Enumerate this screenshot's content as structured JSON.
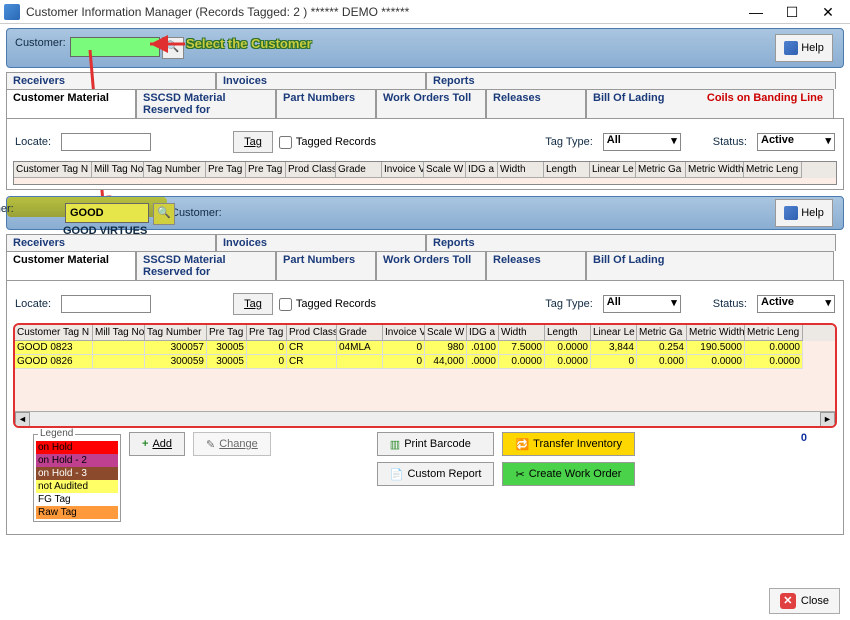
{
  "window": {
    "title": "Customer Information Manager  (Records Tagged:  2 )    ****** DEMO ******",
    "min": "—",
    "max": "☐",
    "close": "✕"
  },
  "toolbar1": {
    "customer_label": "Customer:",
    "customer_value": "",
    "help": "Help"
  },
  "annotation": {
    "select_customer": "Select the Customer"
  },
  "tabs_row1": [
    "Receivers",
    "Invoices",
    "Reports"
  ],
  "tabs_row2": [
    "Customer Material",
    "SSCSD Material Reserved for",
    "Part Numbers",
    "Work Orders Toll",
    "Releases",
    "Bill Of Lading"
  ],
  "banding_text": "Coils on Banding Line",
  "filter": {
    "locate_label": "Locate:",
    "locate_value": "",
    "tag_btn": "Tag",
    "tagged_records": "Tagged Records",
    "tag_type_label": "Tag Type:",
    "tag_type_value": "All",
    "status_label": "Status:",
    "status_value": "Active"
  },
  "columns": [
    "Customer Tag N",
    "Mill Tag No",
    "Tag Number",
    "Pre Tag",
    "Pre Tag",
    "Prod Class",
    "Grade",
    "Invoice V",
    "Scale W",
    "IDG a",
    "Width",
    "Length",
    "Linear Le",
    "Metric Ga",
    "Metric Width",
    "Metric Leng"
  ],
  "toolbar2": {
    "customer_label": "Customer:",
    "customer_value": "GOOD",
    "customer_name": "GOOD VIRTUES",
    "help": "Help"
  },
  "rows": [
    {
      "c1": "GOOD 0823",
      "c2": "",
      "c3": "300057",
      "c4": "30005",
      "c5": "0",
      "c6": "CR",
      "c7": "04MLA",
      "c8": "0",
      "c9": "980",
      "c10": ".0100",
      "c11": "7.5000",
      "c12": "0.0000",
      "c13": "3,844",
      "c14": "0.254",
      "c15": "190.5000",
      "c16": "0.0000"
    },
    {
      "c1": "GOOD 0826",
      "c2": "",
      "c3": "300059",
      "c4": "30005",
      "c5": "0",
      "c6": "CR",
      "c7": "",
      "c8": "0",
      "c9": "44,000",
      "c10": ".0000",
      "c11": "0.0000",
      "c12": "0.0000",
      "c13": "0",
      "c14": "0.000",
      "c15": "0.0000",
      "c16": "0.0000"
    }
  ],
  "legend": {
    "title": "Legend",
    "items": [
      "on Hold",
      "on Hold - 2",
      "on Hold - 3",
      "not Audited",
      "FG Tag",
      "Raw Tag"
    ]
  },
  "action_buttons": {
    "add": "Add",
    "change": "Change",
    "print_barcode": "Print Barcode",
    "custom_report": "Custom Report",
    "transfer_inventory": "Transfer Inventory",
    "create_work_order": "Create Work Order",
    "count": "0"
  },
  "footer": {
    "close": "Close"
  }
}
